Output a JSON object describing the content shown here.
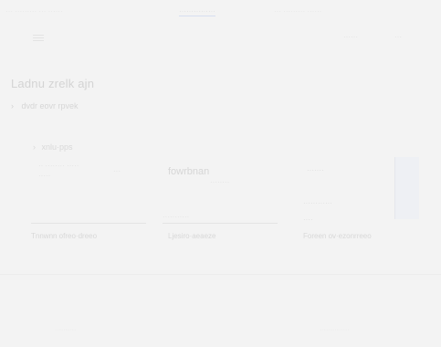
{
  "topbar": {
    "left_text": "··· ········· ··· ······",
    "center_link": "···············",
    "right_text": "··· ········· ······"
  },
  "header": {
    "actions": [
      "······",
      "···"
    ]
  },
  "page": {
    "title": "Ladnu zrelk ajn",
    "subheading": "dvdr eovr rpvek"
  },
  "section": {
    "label": "xnlu·pps"
  },
  "cards": [
    {
      "lines": [
        "·· ········ ·····",
        "·····",
        "···"
      ]
    },
    {
      "logo": "fowrbnan",
      "lines": [
        "········",
        "···········"
      ]
    },
    {
      "lines": [
        "·······",
        "············",
        "····"
      ]
    }
  ],
  "bottom_links": [
    "Tnnwnn ofreo·dreeo",
    "Ljesiro·aeaeze",
    "Foreen ov·ezonrreeo"
  ],
  "footer": {
    "left": "··········",
    "right": "··············"
  }
}
